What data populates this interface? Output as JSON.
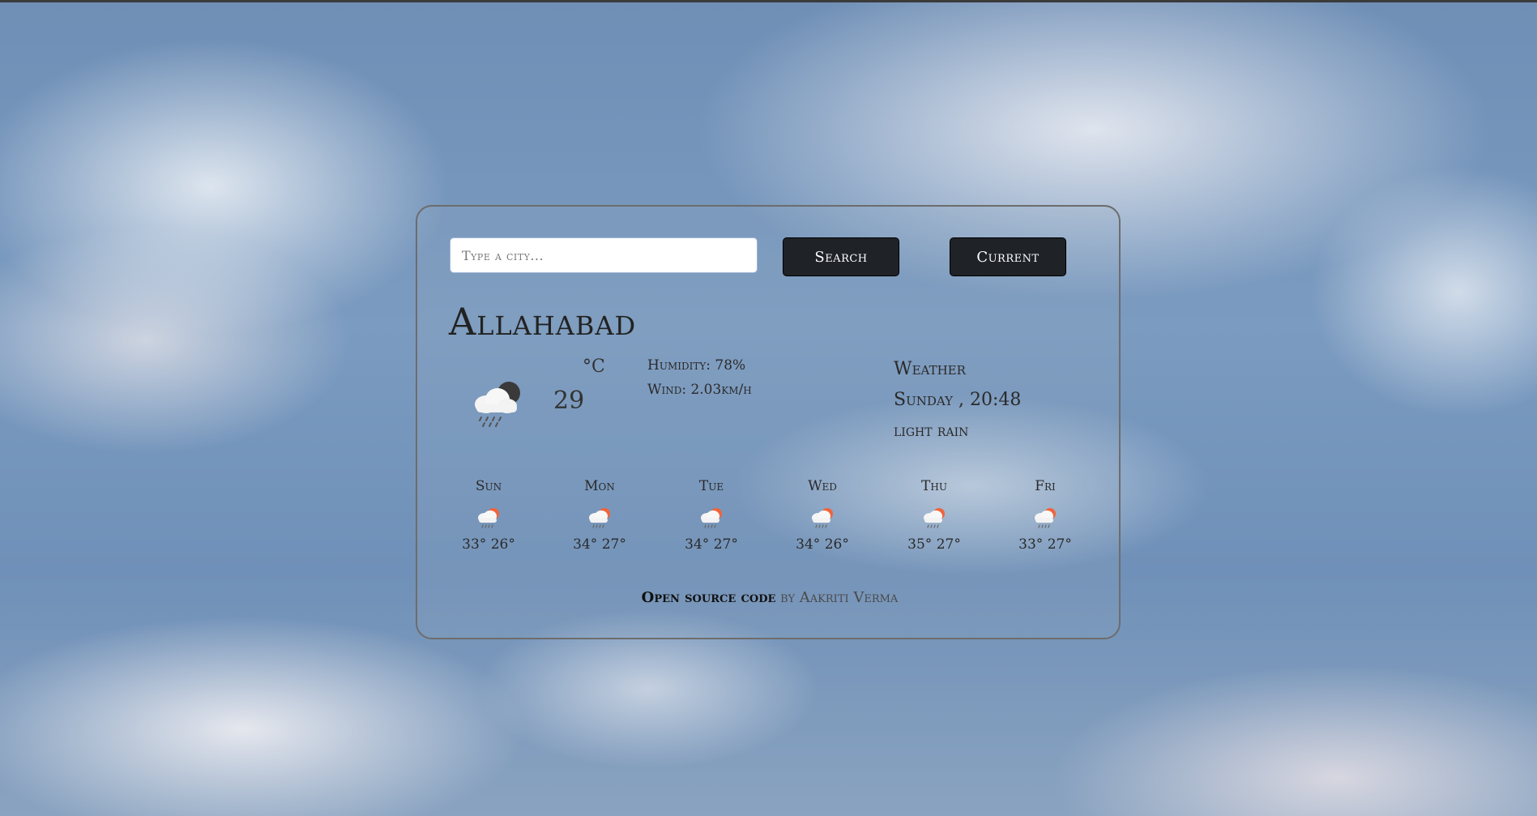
{
  "search": {
    "placeholder": "Type a city..."
  },
  "buttons": {
    "search": "Search",
    "current": "Current"
  },
  "current": {
    "city": "Allahabad",
    "temperature": "29",
    "unit": "°C",
    "humidity": "Humidity: 78%",
    "wind": "Wind: 2.03km/h",
    "weather_label": "Weather",
    "datetime": "Sunday , 20:48",
    "description": "light rain",
    "icon": "night-rain-cloud-icon"
  },
  "forecast": [
    {
      "day": "Sun",
      "temps": "33° 26°",
      "icon": "sun-rain-cloud-icon"
    },
    {
      "day": "Mon",
      "temps": "34° 27°",
      "icon": "sun-rain-cloud-icon"
    },
    {
      "day": "Tue",
      "temps": "34° 27°",
      "icon": "sun-rain-cloud-icon"
    },
    {
      "day": "Wed",
      "temps": "34° 26°",
      "icon": "sun-rain-cloud-icon"
    },
    {
      "day": "Thu",
      "temps": "35° 27°",
      "icon": "sun-rain-cloud-icon"
    },
    {
      "day": "Fri",
      "temps": "33° 27°",
      "icon": "sun-rain-cloud-icon"
    }
  ],
  "footer": {
    "link_text": "Open source code",
    "by_text": "by",
    "author": "Aakriti Verma"
  },
  "colors": {
    "button_bg": "#1f2227",
    "card_border": "#6d6d6d",
    "sun": "#f0643c"
  }
}
